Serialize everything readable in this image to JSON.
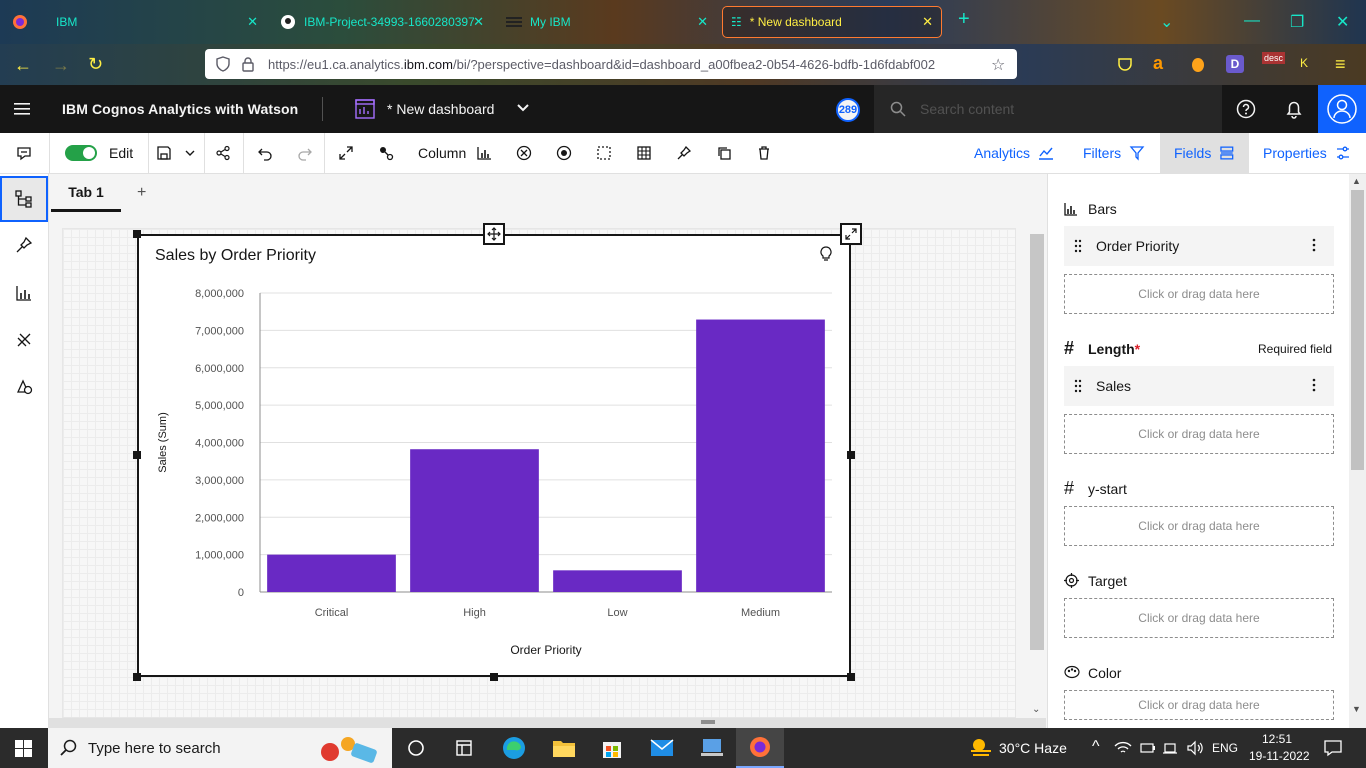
{
  "browser": {
    "tabs": [
      {
        "label": "IBM",
        "active": false
      },
      {
        "label": "IBM-Project-34993-1660280397",
        "active": false
      },
      {
        "label": "My IBM",
        "active": false
      },
      {
        "label": "* New dashboard",
        "active": true
      }
    ],
    "url_prefix": "https://eu1.ca.analytics.",
    "url_domain": "ibm.com",
    "url_suffix": "/bi/?perspective=dashboard&id=dashboard_a00fbea2-0b54-4626-bdfb-1d6fdabf002",
    "ext_badge": "desc",
    "ext_badge_letter": "K"
  },
  "app": {
    "title": "IBM Cognos Analytics with Watson",
    "dashboard_name": "* New dashboard",
    "notification_count": "289",
    "search_placeholder": "Search content"
  },
  "toolbar": {
    "edit_label": "Edit",
    "viz_type_label": "Column",
    "right_tabs": [
      "Analytics",
      "Filters",
      "Fields",
      "Properties"
    ],
    "active_tab": "Fields"
  },
  "canvas": {
    "tab_label": "Tab 1",
    "add_tab_symbol": "+"
  },
  "chart_data": {
    "type": "bar",
    "title": "Sales by Order Priority",
    "xlabel": "Order Priority",
    "ylabel": "Sales (Sum)",
    "categories": [
      "Critical",
      "High",
      "Low",
      "Medium"
    ],
    "values": [
      1000000,
      3820000,
      580000,
      7290000
    ],
    "ylim": [
      0,
      8000000
    ],
    "yticks": [
      "0",
      "1,000,000",
      "2,000,000",
      "3,000,000",
      "4,000,000",
      "5,000,000",
      "6,000,000",
      "7,000,000",
      "8,000,000"
    ],
    "bar_color": "#6929c4",
    "grid": true
  },
  "fields_panel": {
    "bars": {
      "label": "Bars",
      "field": "Order Priority",
      "drop": "Click or drag data here"
    },
    "length": {
      "label": "Length",
      "required_mark": "*",
      "required_text": "Required field",
      "field": "Sales",
      "drop": "Click or drag data here"
    },
    "ystart": {
      "label": "y-start",
      "drop": "Click or drag data here"
    },
    "target": {
      "label": "Target",
      "drop": "Click or drag data here"
    },
    "color": {
      "label": "Color",
      "drop": "Click or drag data here"
    }
  },
  "taskbar": {
    "search_placeholder": "Type here to search",
    "weather": "30°C  Haze",
    "lang": "ENG",
    "time": "12:51",
    "date": "19-11-2022"
  }
}
